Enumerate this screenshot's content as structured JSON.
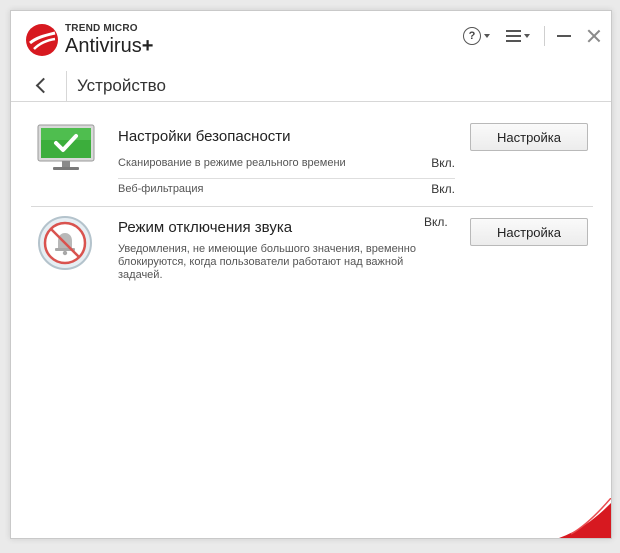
{
  "brand": {
    "company": "TREND MICRO",
    "product": "Antivirus",
    "product_suffix": "+"
  },
  "window_controls": {
    "help_icon": "question-circle-icon",
    "menu_icon": "hamburger-menu-icon",
    "minimize_icon": "minimize-icon",
    "close_icon": "close-icon"
  },
  "nav": {
    "back_icon": "chevron-left-icon",
    "title": "Устройство"
  },
  "sections": {
    "security": {
      "icon": "monitor-check-icon",
      "title": "Настройки безопасности",
      "rows": [
        {
          "label": "Сканирование в режиме реального времени",
          "status": "Вкл."
        },
        {
          "label": "Веб-фильтрация",
          "status": "Вкл."
        }
      ],
      "button": "Настройка"
    },
    "mute": {
      "icon": "bell-muted-icon",
      "title": "Режим отключения звука",
      "status": "Вкл.",
      "description": "Уведомления, не имеющие большого значения, временно блокируются, когда пользователи работают над важной задачей.",
      "button": "Настройка"
    }
  },
  "colors": {
    "brand_red": "#d71920",
    "check_green": "#3cae3c",
    "mute_red": "#d9534f"
  }
}
